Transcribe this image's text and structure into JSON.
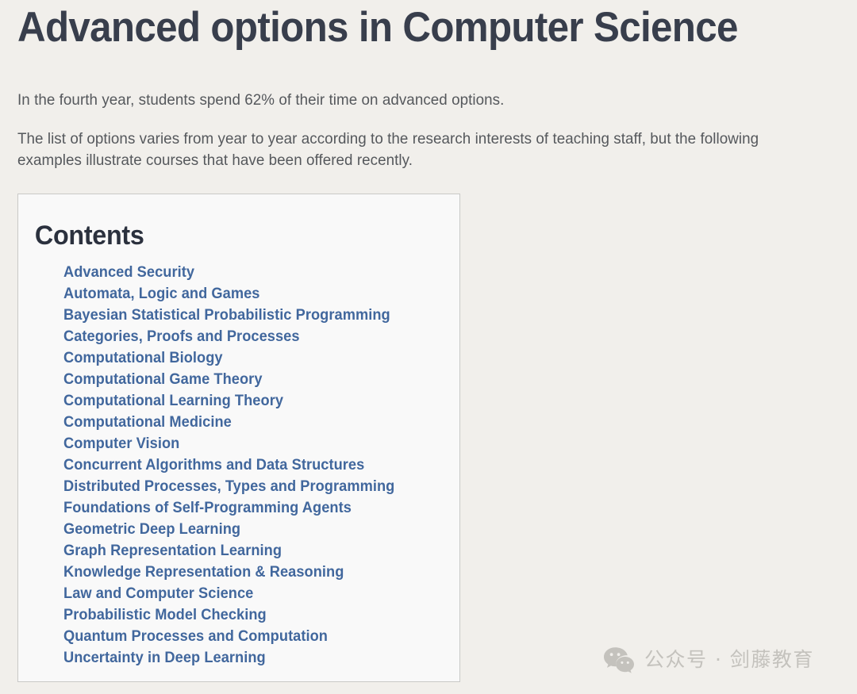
{
  "page": {
    "title": "Advanced options in Computer Science",
    "background_color": "#f1efeb",
    "title_color": "#383e4c",
    "body_text_color": "#55585c",
    "link_color": "#41679d"
  },
  "intro": {
    "paragraph_1": "In the fourth year, students spend 62% of their time on advanced options.",
    "paragraph_2": "The list of options varies from year to year according to the research interests of teaching staff, but the following examples illustrate courses that have been offered recently."
  },
  "contents": {
    "heading": "Contents",
    "border_color": "#c9c9c7",
    "background_color": "#f9f9f9",
    "items": [
      {
        "label": "Advanced Security"
      },
      {
        "label": "Automata, Logic and Games"
      },
      {
        "label": "Bayesian Statistical Probabilistic Programming"
      },
      {
        "label": "Categories, Proofs and Processes"
      },
      {
        "label": "Computational Biology"
      },
      {
        "label": "Computational Game Theory"
      },
      {
        "label": "Computational Learning Theory"
      },
      {
        "label": "Computational Medicine"
      },
      {
        "label": "Computer Vision"
      },
      {
        "label": "Concurrent Algorithms and Data Structures"
      },
      {
        "label": "Distributed Processes, Types and Programming"
      },
      {
        "label": "Foundations of Self-Programming Agents"
      },
      {
        "label": "Geometric Deep Learning"
      },
      {
        "label": "Graph Representation Learning"
      },
      {
        "label": "Knowledge Representation & Reasoning"
      },
      {
        "label": "Law and Computer Science"
      },
      {
        "label": "Probabilistic Model Checking"
      },
      {
        "label": "Quantum Processes and Computation"
      },
      {
        "label": "Uncertainty in Deep Learning"
      }
    ]
  },
  "watermark": {
    "icon": "wechat-icon",
    "text": "公众号 · 剑藤教育",
    "color": "#c4c2bd"
  }
}
